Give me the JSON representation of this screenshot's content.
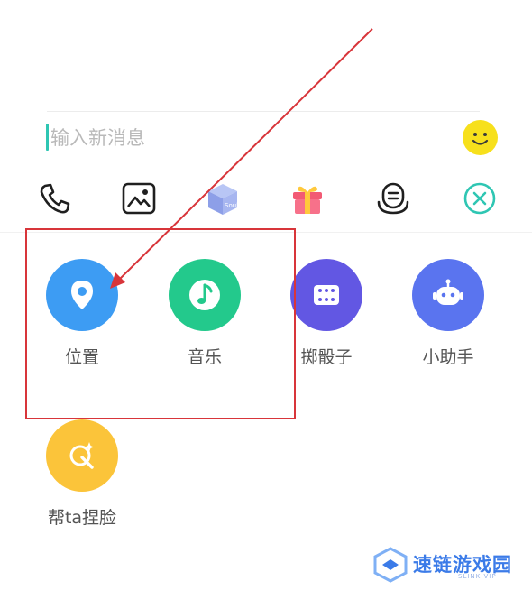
{
  "input": {
    "placeholder": "输入新消息"
  },
  "toolbar": {
    "items": [
      {
        "name": "phone-icon"
      },
      {
        "name": "image-icon"
      },
      {
        "name": "soul-box-icon",
        "badge": "Soul"
      },
      {
        "name": "gift-icon"
      },
      {
        "name": "voice-robot-icon"
      },
      {
        "name": "close-icon"
      }
    ]
  },
  "panel": {
    "items": [
      {
        "label": "位置",
        "icon": "location-pin-icon",
        "color": "#3d9cf3"
      },
      {
        "label": "音乐",
        "icon": "music-note-icon",
        "color": "#23c98c"
      },
      {
        "label": "掷骰子",
        "icon": "dice-icon",
        "color": "#6257e3"
      },
      {
        "label": "小助手",
        "icon": "robot-icon",
        "color": "#5a74ef"
      },
      {
        "label": "帮ta捏脸",
        "icon": "face-sparkle-icon",
        "color": "#fbc43a"
      }
    ]
  },
  "watermark": {
    "text": "速链游戏园",
    "sub": "SLINK.VIP"
  },
  "colors": {
    "accent": "#2fc6b3",
    "annotation": "#d8353a"
  }
}
